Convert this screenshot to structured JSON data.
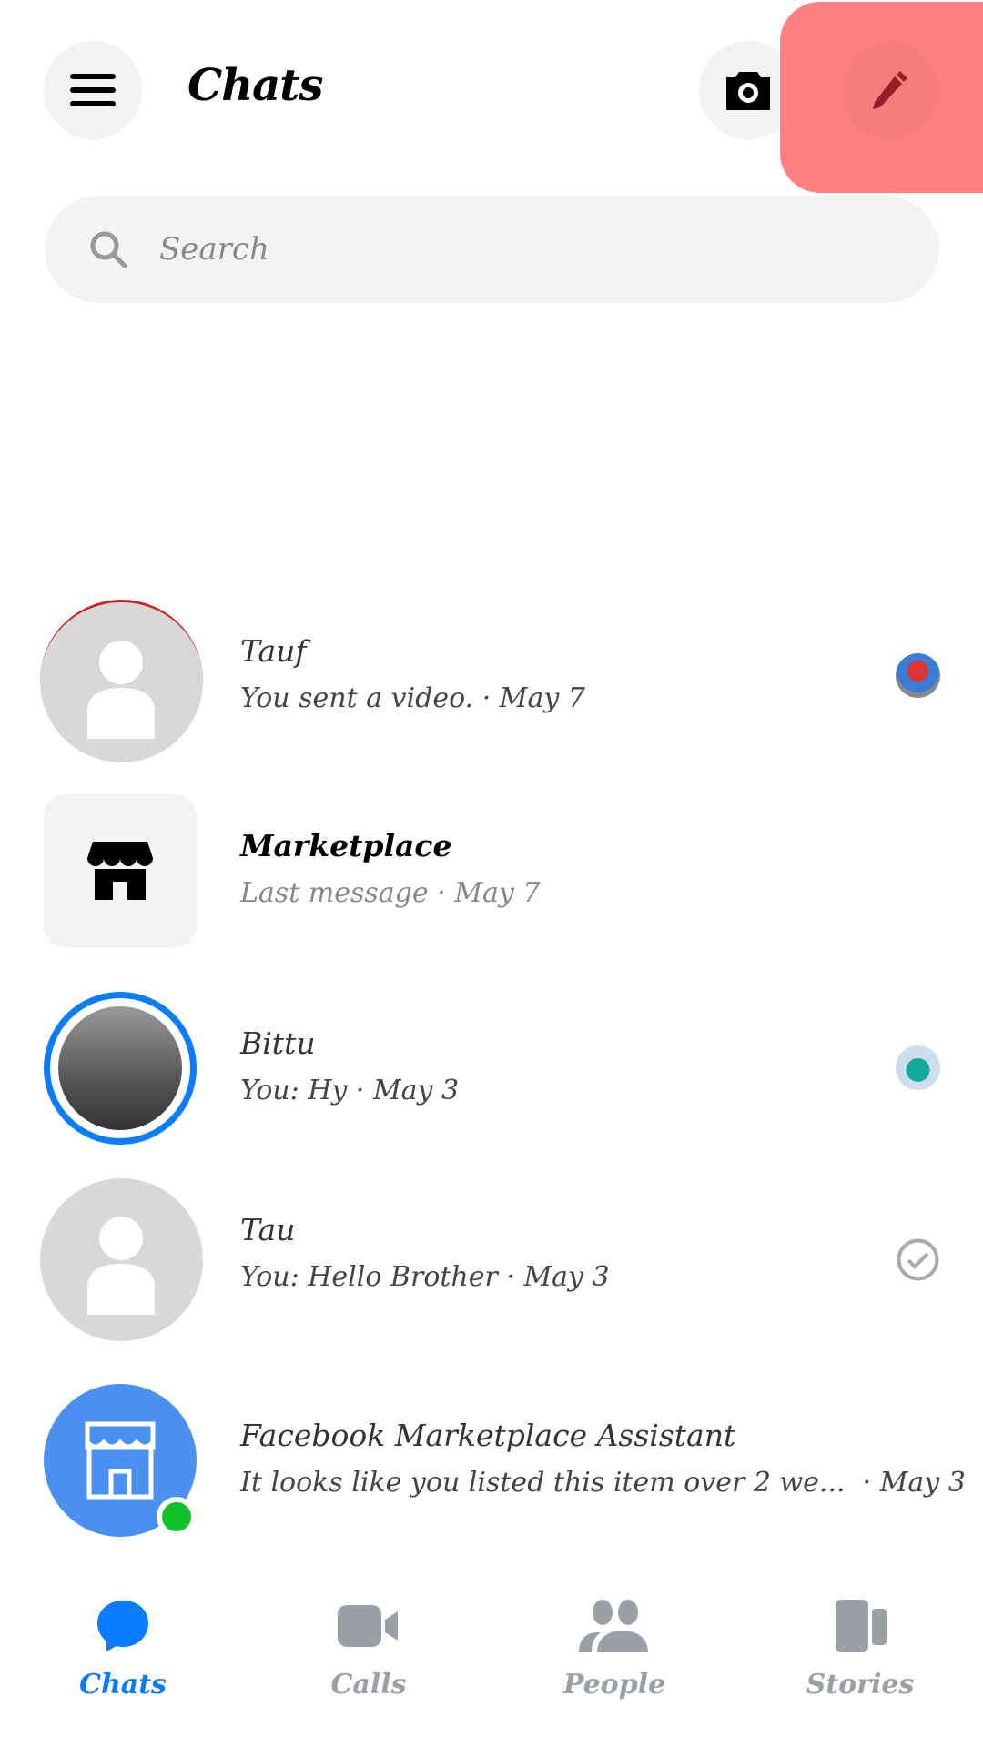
{
  "header": {
    "title": "Chats",
    "menu_icon": "hamburger-icon",
    "camera_icon": "camera-icon",
    "compose_icon": "pencil-icon"
  },
  "search": {
    "placeholder": "Search"
  },
  "chats": [
    {
      "name": "Tauf",
      "subtitle": "You sent a video. · May 7",
      "avatar": "default-person",
      "status": "seen-avatar"
    },
    {
      "name": "Marketplace",
      "subtitle": "Last message · May 7",
      "avatar": "marketplace-store"
    },
    {
      "name": "Bittu",
      "subtitle": "You: Hy · May 3",
      "avatar": "photo-with-story-ring",
      "status": "seen-avatar"
    },
    {
      "name": "Tau",
      "subtitle": "You: Hello Brother · May 3",
      "avatar": "default-person",
      "status": "sent-check"
    },
    {
      "name": "Facebook Marketplace Assistant",
      "subtitle": "It looks like you listed this item over 2 we...  · May 3",
      "avatar": "marketplace-blue",
      "online": true
    }
  ],
  "nav": {
    "tabs": [
      {
        "label": "Chats",
        "active": true
      },
      {
        "label": "Calls"
      },
      {
        "label": "People"
      },
      {
        "label": "Stories"
      }
    ]
  },
  "colors": {
    "accent": "#0a7cff",
    "inactive": "#9aa0a6",
    "online": "#0fc22a",
    "highlight": "#ff8080"
  }
}
